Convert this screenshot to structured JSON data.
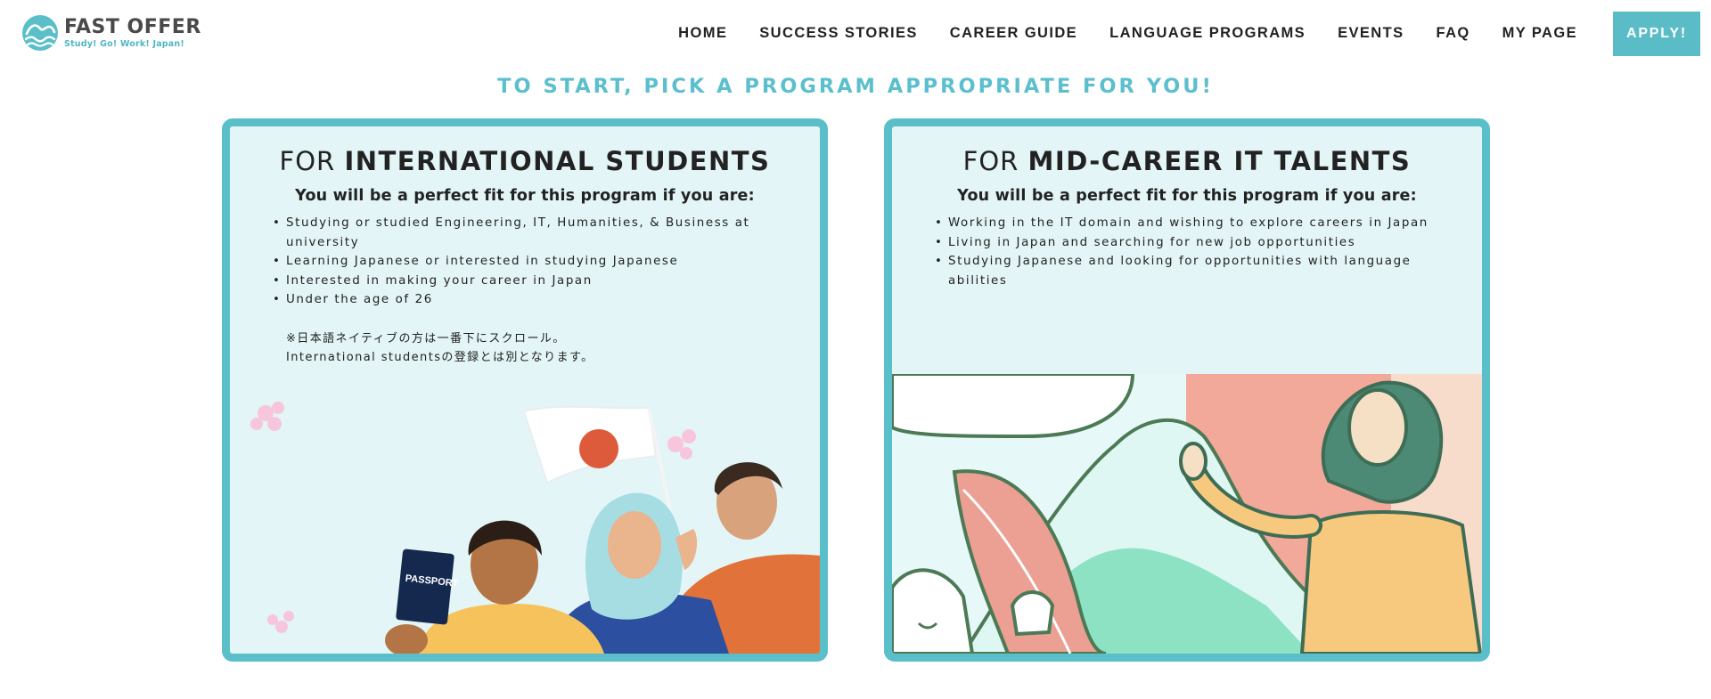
{
  "brand": {
    "name": "FAST OFFER",
    "tagline": "Study! Go! Work! Japan!",
    "accent": "#5bbfca"
  },
  "nav": {
    "items": [
      "HOME",
      "SUCCESS STORIES",
      "CAREER GUIDE",
      "LANGUAGE PROGRAMS",
      "EVENTS",
      "FAQ",
      "MY PAGE"
    ],
    "apply_label": "APPLY!"
  },
  "headline": "TO START, PICK A PROGRAM APPROPRIATE FOR YOU!",
  "cards": [
    {
      "title_prefix": "FOR",
      "title_bold": "INTERNATIONAL STUDENTS",
      "fit_text": "You will be a perfect fit for this program if you are:",
      "criteria": [
        "Studying or studied Engineering, IT, Humanities, & Business at university",
        "Learning Japanese or interested in studying Japanese",
        "Interested in making your career in Japan",
        "Under the age of 26"
      ],
      "note_line1": "※日本語ネイティブの方は一番下にスクロール。",
      "note_line2": "International studentsの登録とは別となります。",
      "illustration": {
        "passport_label": "PASSPORT"
      }
    },
    {
      "title_prefix": "FOR",
      "title_bold": "MID-CAREER IT TALENTS",
      "fit_text": "You will be a perfect fit for this program if you are:",
      "criteria": [
        "Working in the IT domain and wishing to explore careers in Japan",
        "Living in Japan and searching for new job opportunities",
        "Studying Japanese and looking for opportunities with language abilities"
      ]
    }
  ]
}
